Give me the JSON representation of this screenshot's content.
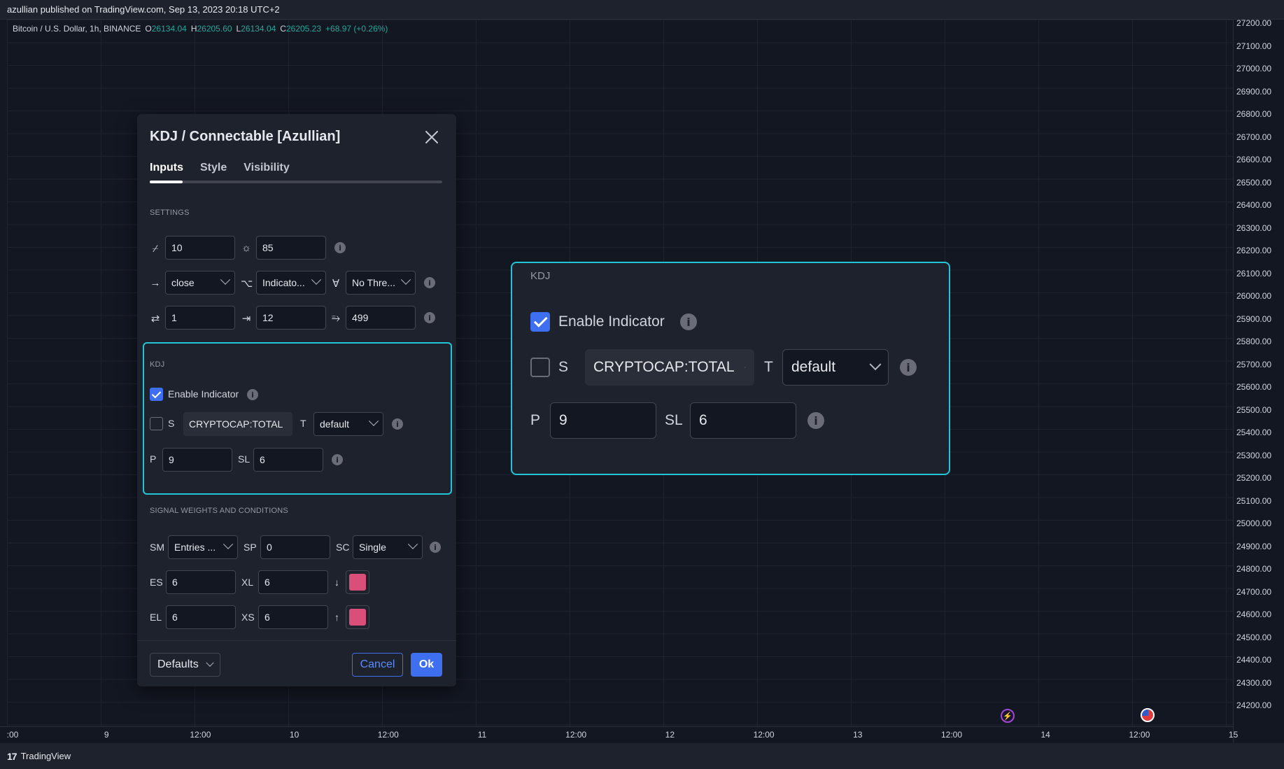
{
  "topbar": {
    "text": "azullian published on TradingView.com, Sep 13, 2023 20:18 UTC+2"
  },
  "legend": {
    "symbol": "Bitcoin / U.S. Dollar, 1h, BINANCE",
    "open_key": "O",
    "open": "26134.04",
    "high_key": "H",
    "high": "26205.60",
    "low_key": "L",
    "low": "26134.04",
    "close_key": "C",
    "close": "26205.23",
    "change": "+68.97 (+0.26%)"
  },
  "price_axis": [
    "27200.00",
    "27100.00",
    "27000.00",
    "26900.00",
    "26800.00",
    "26700.00",
    "26600.00",
    "26500.00",
    "26400.00",
    "26300.00",
    "26200.00",
    "26100.00",
    "26000.00",
    "25900.00",
    "25800.00",
    "25700.00",
    "25600.00",
    "25500.00",
    "25400.00",
    "25300.00",
    "25200.00",
    "25100.00",
    "25000.00",
    "24900.00",
    "24800.00",
    "24700.00",
    "24600.00",
    "24500.00",
    "24400.00",
    "24300.00",
    "24200.00"
  ],
  "time_axis": [
    ":00",
    "9",
    "12:00",
    "10",
    "12:00",
    "11",
    "12:00",
    "12",
    "12:00",
    "13",
    "12:00",
    "14",
    "12:00",
    "15"
  ],
  "bottombar": {
    "logo": "17",
    "brand": "TradingView"
  },
  "dialog": {
    "title": "KDJ / Connectable [Azullian]",
    "tabs": [
      "Inputs",
      "Style",
      "Visibility"
    ],
    "settings_title": "SETTINGS",
    "row1": {
      "v1": "10",
      "v2": "85"
    },
    "row2": {
      "s1": "close",
      "s2": "Indicato...",
      "s3": "No Thre..."
    },
    "row3": {
      "v1": "1",
      "v2": "12",
      "v3": "499"
    },
    "kdj": {
      "section": "KDJ",
      "enable_label": "Enable Indicator",
      "enable_checked": true,
      "s_label": "S",
      "s_checked": false,
      "symbol": "CRYPTOCAP:TOTAL",
      "t_label": "T",
      "t_value": "default",
      "p_label": "P",
      "p_value": "9",
      "sl_label": "SL",
      "sl_value": "6"
    },
    "signal": {
      "section": "SIGNAL WEIGHTS AND CONDITIONS",
      "sm_label": "SM",
      "sm_value": "Entries ...",
      "sp_label": "SP",
      "sp_value": "0",
      "sc_label": "SC",
      "sc_value": "Single",
      "es_label": "ES",
      "es_value": "6",
      "xl_label": "XL",
      "xl_value": "6",
      "el_label": "EL",
      "el_value": "6",
      "xs_label": "XS",
      "xs_value": "6",
      "down_arrow": "↓",
      "up_arrow": "↑",
      "swatch_color": "#d94f7a"
    },
    "footer": {
      "defaults": "Defaults",
      "cancel": "Cancel",
      "ok": "Ok"
    }
  },
  "zoom": {
    "section": "KDJ",
    "enable_label": "Enable Indicator",
    "s_label": "S",
    "symbol": "CRYPTOCAP:TOTAL",
    "t_label": "T",
    "t_value": "default",
    "p_label": "P",
    "p_value": "9",
    "sl_label": "SL",
    "sl_value": "6"
  },
  "colors": {
    "accent": "#3d6ff0",
    "highlight": "#22c5d6",
    "up": "#26a69a",
    "background": "#131722",
    "panel": "#1e222d"
  }
}
